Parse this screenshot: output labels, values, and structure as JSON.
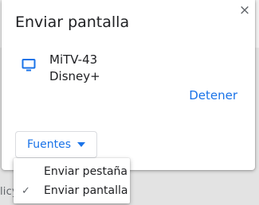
{
  "dialog": {
    "title": "Enviar pantalla",
    "close_glyph": "×",
    "device": {
      "icon": "tv-icon",
      "name": "MiTV-43",
      "status": "Disney+"
    },
    "stop_label": "Detener",
    "sources_label": "Fuentes"
  },
  "menu": {
    "items": [
      {
        "label": "Enviar pestaña",
        "checked": false
      },
      {
        "label": "Enviar pantalla",
        "checked": true
      }
    ],
    "check_glyph": "✓"
  },
  "background": {
    "snippet": "licy"
  },
  "colors": {
    "accent": "#1a73e8",
    "text": "#202124",
    "muted": "#5f6368"
  }
}
